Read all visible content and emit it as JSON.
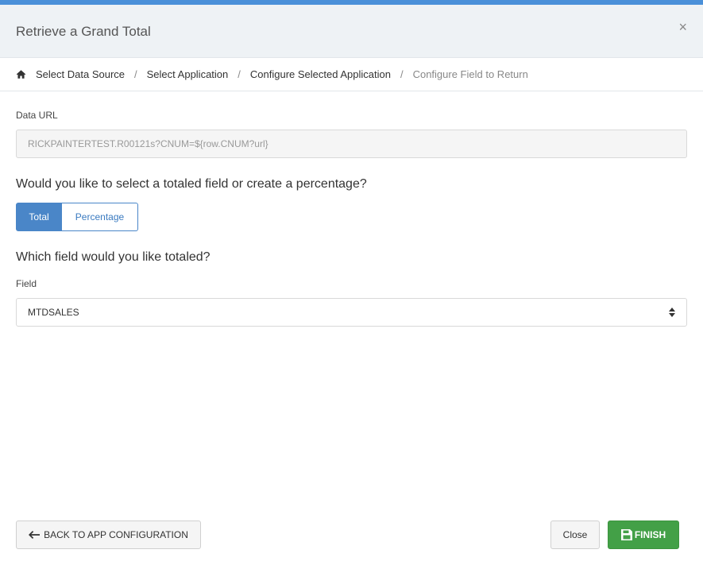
{
  "modal": {
    "title": "Retrieve a Grand Total",
    "close_symbol": "×"
  },
  "breadcrumb": {
    "items": [
      {
        "label": "Select Data Source"
      },
      {
        "label": "Select Application"
      },
      {
        "label": "Configure Selected Application"
      },
      {
        "label": "Configure Field to Return"
      }
    ],
    "separator": "/"
  },
  "data_url": {
    "label": "Data URL",
    "value": "RICKPAINTERTEST.R00121s?CNUM=${row.CNUM?url}"
  },
  "mode": {
    "question": "Would you like to select a totaled field or create a percentage?",
    "options": [
      "Total",
      "Percentage"
    ],
    "selected": "Total"
  },
  "field": {
    "question": "Which field would you like totaled?",
    "label": "Field",
    "value": "MTDSALES"
  },
  "footer": {
    "back_label": "BACK TO APP CONFIGURATION",
    "close_label": "Close",
    "finish_label": "FINISH"
  },
  "colors": {
    "accent": "#4a90d9",
    "toggle_active": "#4a86c8",
    "finish": "#43a047"
  },
  "icons": {
    "home": "home-icon",
    "back": "arrow-left-icon",
    "finish": "save-icon",
    "select": "sort-icon"
  }
}
